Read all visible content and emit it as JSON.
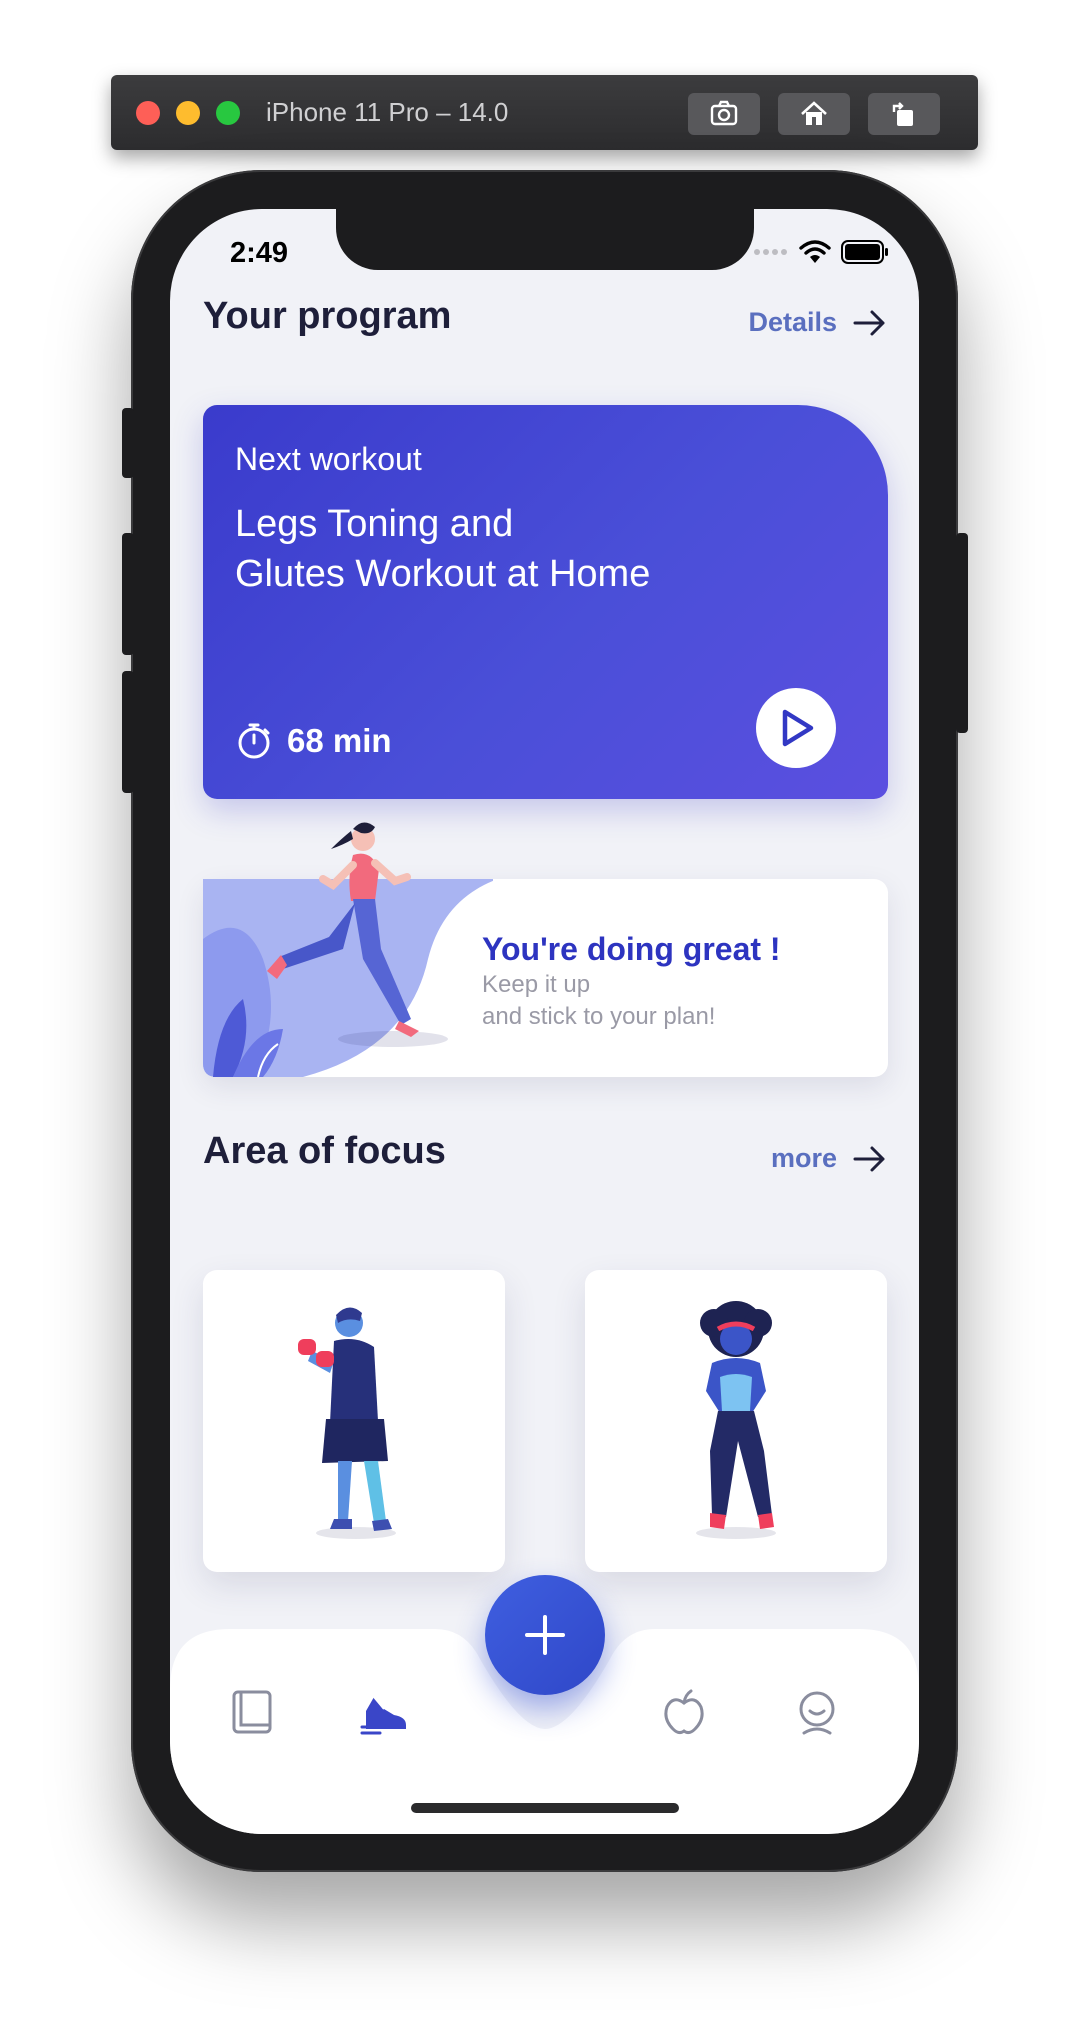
{
  "simulator": {
    "title": "iPhone 11 Pro – 14.0",
    "buttons": [
      "screenshot-icon",
      "home-icon",
      "rotate-icon"
    ]
  },
  "status_bar": {
    "time": "2:49"
  },
  "program": {
    "title": "Your program",
    "link_label": "Details"
  },
  "workout_card": {
    "label": "Next workout",
    "title_line1": "Legs Toning and",
    "title_line2": "Glutes Workout at Home",
    "duration": "68 min"
  },
  "motivation": {
    "heading": "You're doing great !",
    "line1": "Keep it up",
    "line2": "and stick to your plan!"
  },
  "focus": {
    "title": "Area of focus",
    "link_label": "more",
    "tiles": [
      "boxer-illustration",
      "woman-figure-illustration"
    ]
  },
  "tab_bar": {
    "items": [
      "book-icon",
      "sneaker-icon",
      "add-icon",
      "apple-icon",
      "profile-icon"
    ],
    "active": "sneaker-icon"
  },
  "colors": {
    "accent": "#3a3bcc",
    "link": "#5a6fbf",
    "heading": "#1e1f3a",
    "motivation_heading": "#2d34c0",
    "screen_bg": "#f1f2f7"
  }
}
